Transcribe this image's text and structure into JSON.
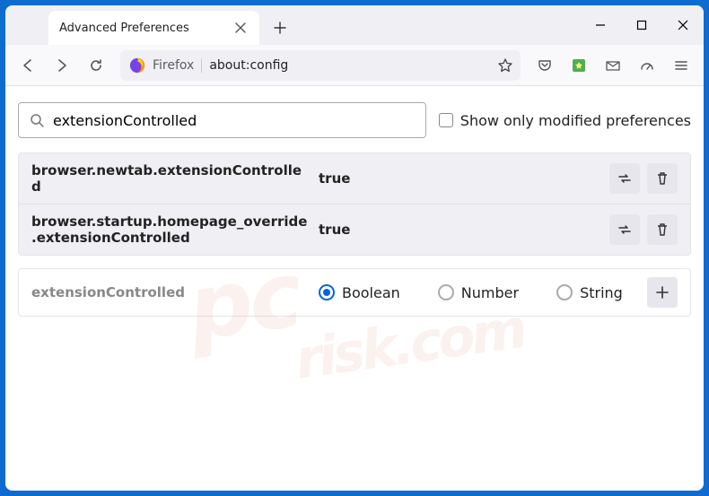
{
  "tab": {
    "title": "Advanced Preferences"
  },
  "urlbar": {
    "identity_label": "Firefox",
    "url": "about:config"
  },
  "search": {
    "value": "extensionControlled",
    "checkbox_label": "Show only modified preferences"
  },
  "prefs": [
    {
      "name": "browser.newtab.extensionControlled",
      "value": "true"
    },
    {
      "name": "browser.startup.homepage_override.extensionControlled",
      "value": "true"
    }
  ],
  "add": {
    "name": "extensionControlled",
    "types": {
      "boolean": "Boolean",
      "number": "Number",
      "string": "String"
    }
  },
  "watermark": {
    "line1": "pc",
    "line2": "risk.com"
  }
}
